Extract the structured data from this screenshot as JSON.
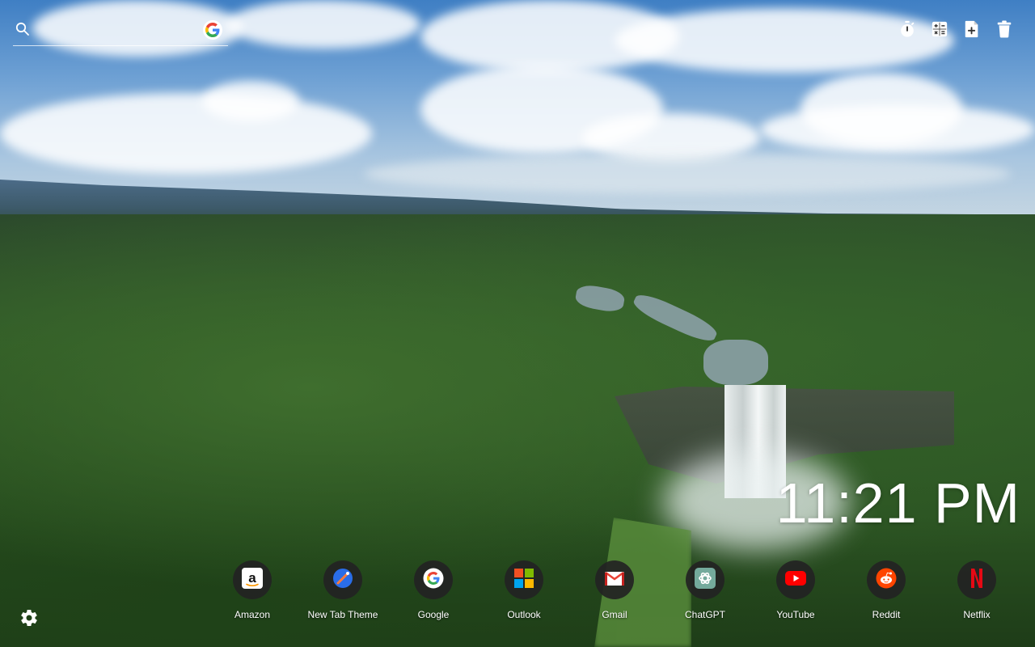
{
  "search": {
    "placeholder": "",
    "value": "",
    "engine_icon": "google-icon"
  },
  "toolbar": {
    "items": [
      {
        "name": "timer",
        "icon": "stopwatch-icon"
      },
      {
        "name": "calculator",
        "icon": "calculator-icon"
      },
      {
        "name": "new-note",
        "icon": "add-note-icon"
      },
      {
        "name": "trash",
        "icon": "trash-icon"
      }
    ]
  },
  "clock": {
    "time": "11:21 PM"
  },
  "shortcuts": [
    {
      "label": "Amazon",
      "icon": "amazon-icon"
    },
    {
      "label": "New Tab Theme",
      "icon": "new-tab-theme-icon"
    },
    {
      "label": "Google",
      "icon": "google-icon"
    },
    {
      "label": "Outlook",
      "icon": "microsoft-icon"
    },
    {
      "label": "Gmail",
      "icon": "gmail-icon"
    },
    {
      "label": "ChatGPT",
      "icon": "chatgpt-icon"
    },
    {
      "label": "YouTube",
      "icon": "youtube-icon"
    },
    {
      "label": "Reddit",
      "icon": "reddit-icon"
    },
    {
      "label": "Netflix",
      "icon": "netflix-icon"
    }
  ],
  "settings": {
    "icon": "gear-icon"
  },
  "background": {
    "icon": "waterfall-landscape"
  }
}
